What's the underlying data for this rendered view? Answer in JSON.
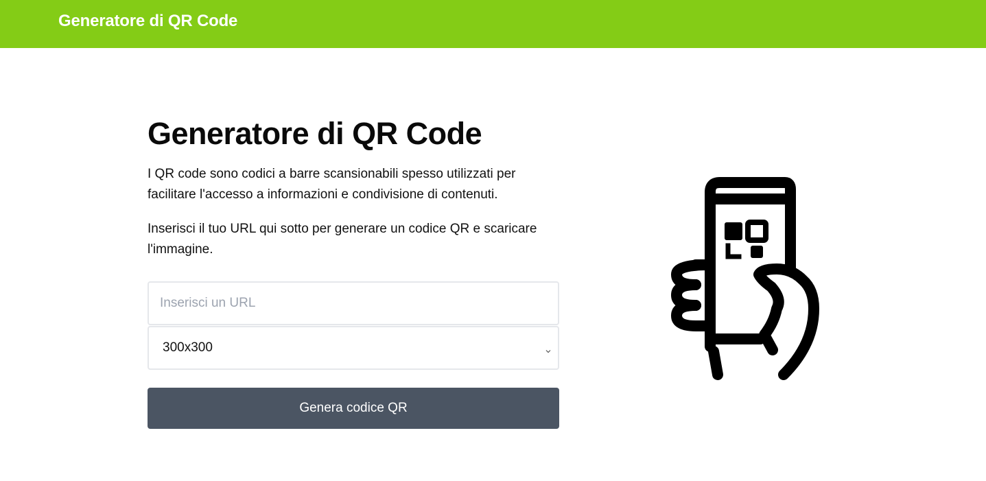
{
  "header": {
    "title": "Generatore di QR Code",
    "background_color": "#84cc16"
  },
  "main": {
    "title": "Generatore di QR Code",
    "description": "I QR code sono codici a barre scansionabili spesso utilizzati per facilitare l'accesso a informazioni e condivisione di contenuti.",
    "instructions": "Inserisci il tuo URL qui sotto per generare un codice QR e scaricare l'immagine."
  },
  "form": {
    "url_input": {
      "value": "",
      "placeholder": "Inserisci un URL"
    },
    "size_select": {
      "selected": "300x300",
      "icon": "chevron-down-icon"
    },
    "generate_button": {
      "label": "Genera codice QR",
      "color": "#4b5563"
    }
  },
  "illustration": {
    "icon": "phone-qr-scan-icon"
  }
}
